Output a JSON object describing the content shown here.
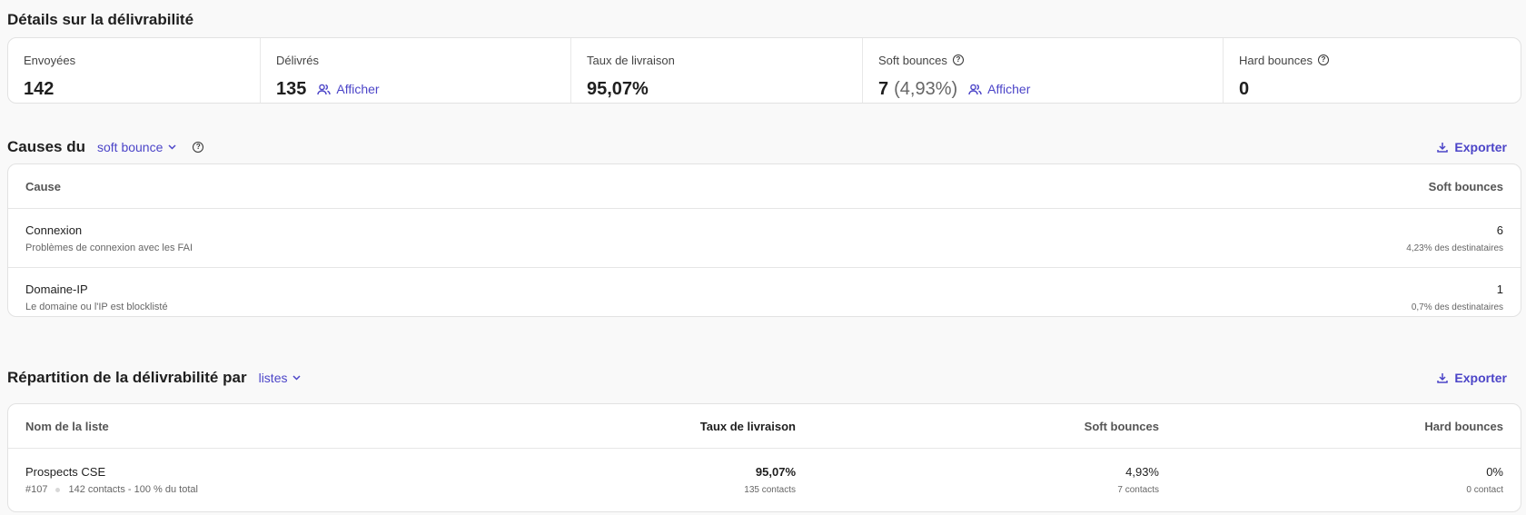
{
  "deliverability": {
    "title": "Détails sur la délivrabilité",
    "stats": [
      {
        "label": "Envoyées",
        "value": "142"
      },
      {
        "label": "Délivrés",
        "value": "135",
        "action": "Afficher"
      },
      {
        "label": "Taux de livraison",
        "value": "95,07%"
      },
      {
        "label": "Soft bounces",
        "value": "7",
        "pct": "(4,93%)",
        "action": "Afficher"
      },
      {
        "label": "Hard bounces",
        "value": "0"
      }
    ]
  },
  "causes": {
    "title": "Causes du",
    "dropdown": "soft bounce",
    "export": "Exporter",
    "columns": {
      "cause": "Cause",
      "count": "Soft bounces"
    },
    "rows": [
      {
        "name": "Connexion",
        "desc": "Problèmes de connexion avec les FAI",
        "count": "6",
        "share": "4,23% des destinataires"
      },
      {
        "name": "Domaine-IP",
        "desc": "Le domaine ou l'IP est blocklisté",
        "count": "1",
        "share": "0,7% des destinataires"
      }
    ]
  },
  "breakdown": {
    "title": "Répartition de la délivrabilité par",
    "dropdown": "listes",
    "export": "Exporter",
    "columns": {
      "name": "Nom de la liste",
      "rate": "Taux de livraison",
      "soft": "Soft bounces",
      "hard": "Hard bounces"
    },
    "rows": [
      {
        "name": "Prospects CSE",
        "id": "#107",
        "contacts": "142 contacts - 100 % du total",
        "rate": "95,07%",
        "rate_sub": "135 contacts",
        "soft": "4,93%",
        "soft_sub": "7 contacts",
        "hard": "0%",
        "hard_sub": "0 contact"
      }
    ]
  },
  "colors": {
    "accent": "#4c45c8",
    "border": "#e2e2e2",
    "background": "#f9f9f9"
  }
}
